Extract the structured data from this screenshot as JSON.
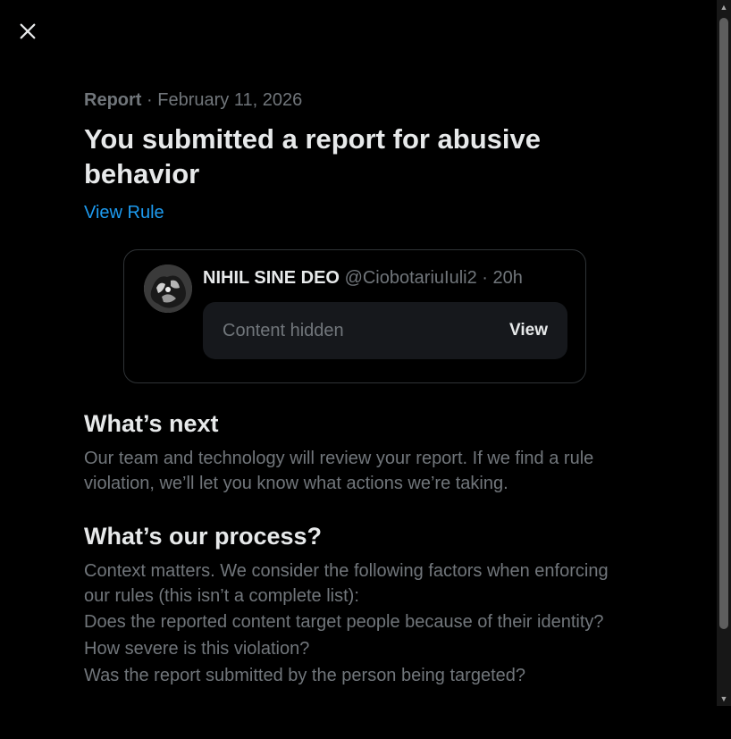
{
  "report": {
    "label": "Report",
    "separator": " · ",
    "date": "February 11, 2026",
    "title": "You submitted a report for abusive behavior",
    "view_rule": "View Rule"
  },
  "tweet": {
    "author_name": "NIHIL SINE DEO",
    "author_handle": "@CiobotariuIuli2 · 20h",
    "hidden_label": "Content hidden",
    "view_button": "View"
  },
  "whats_next": {
    "heading": "What’s next",
    "body": "Our team and technology will review your report. If we find a rule violation, we’ll let you know what actions we’re taking."
  },
  "process": {
    "heading": "What’s our process?",
    "intro": "Context matters. We consider the following factors when enforcing our rules (this isn’t a complete list):",
    "factors": [
      "Does the reported content target people because of their identity?",
      "How severe is this violation?",
      "Was the report submitted by the person being targeted?"
    ]
  },
  "icons": {
    "close": "close-icon",
    "scroll_up": "scroll-up-arrow-icon",
    "scroll_down": "scroll-down-arrow-icon"
  },
  "colors": {
    "background": "#000000",
    "text_primary": "#e7e9ea",
    "text_secondary": "#71767b",
    "link": "#1d9bf0",
    "card_border": "#2f3336",
    "hidden_box": "#16181c"
  }
}
